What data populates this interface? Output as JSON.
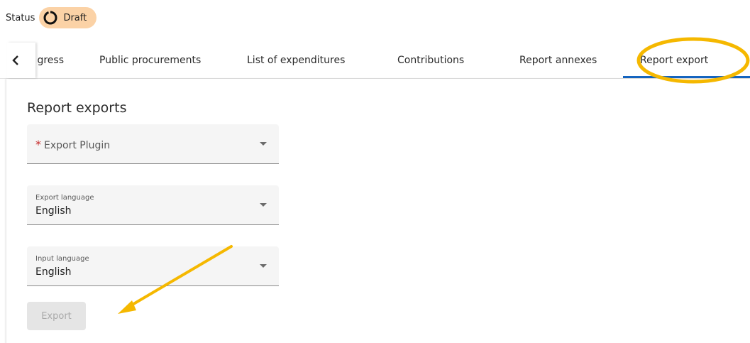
{
  "status": {
    "label": "Status",
    "badge": "Draft",
    "badge_icon": "progress-circle-icon",
    "badge_color": "#fbd2a6"
  },
  "tabs": {
    "back_icon": "chevron-left-icon",
    "items": [
      {
        "label": "Progress",
        "visible_text": "gress"
      },
      {
        "label": "Public procurements"
      },
      {
        "label": "List of expenditures"
      },
      {
        "label": "Contributions"
      },
      {
        "label": "Report annexes"
      },
      {
        "label": "Report export",
        "active": true
      }
    ],
    "active_color": "#1565c0"
  },
  "main": {
    "title": "Report exports",
    "export_plugin": {
      "label": "Export Plugin",
      "required": true,
      "value": ""
    },
    "export_language": {
      "label": "Export language",
      "value": "English"
    },
    "input_language": {
      "label": "Input language",
      "value": "English"
    },
    "export_button": {
      "label": "Export",
      "disabled": true
    }
  },
  "annotations": {
    "highlight_color": "#f5b800"
  }
}
